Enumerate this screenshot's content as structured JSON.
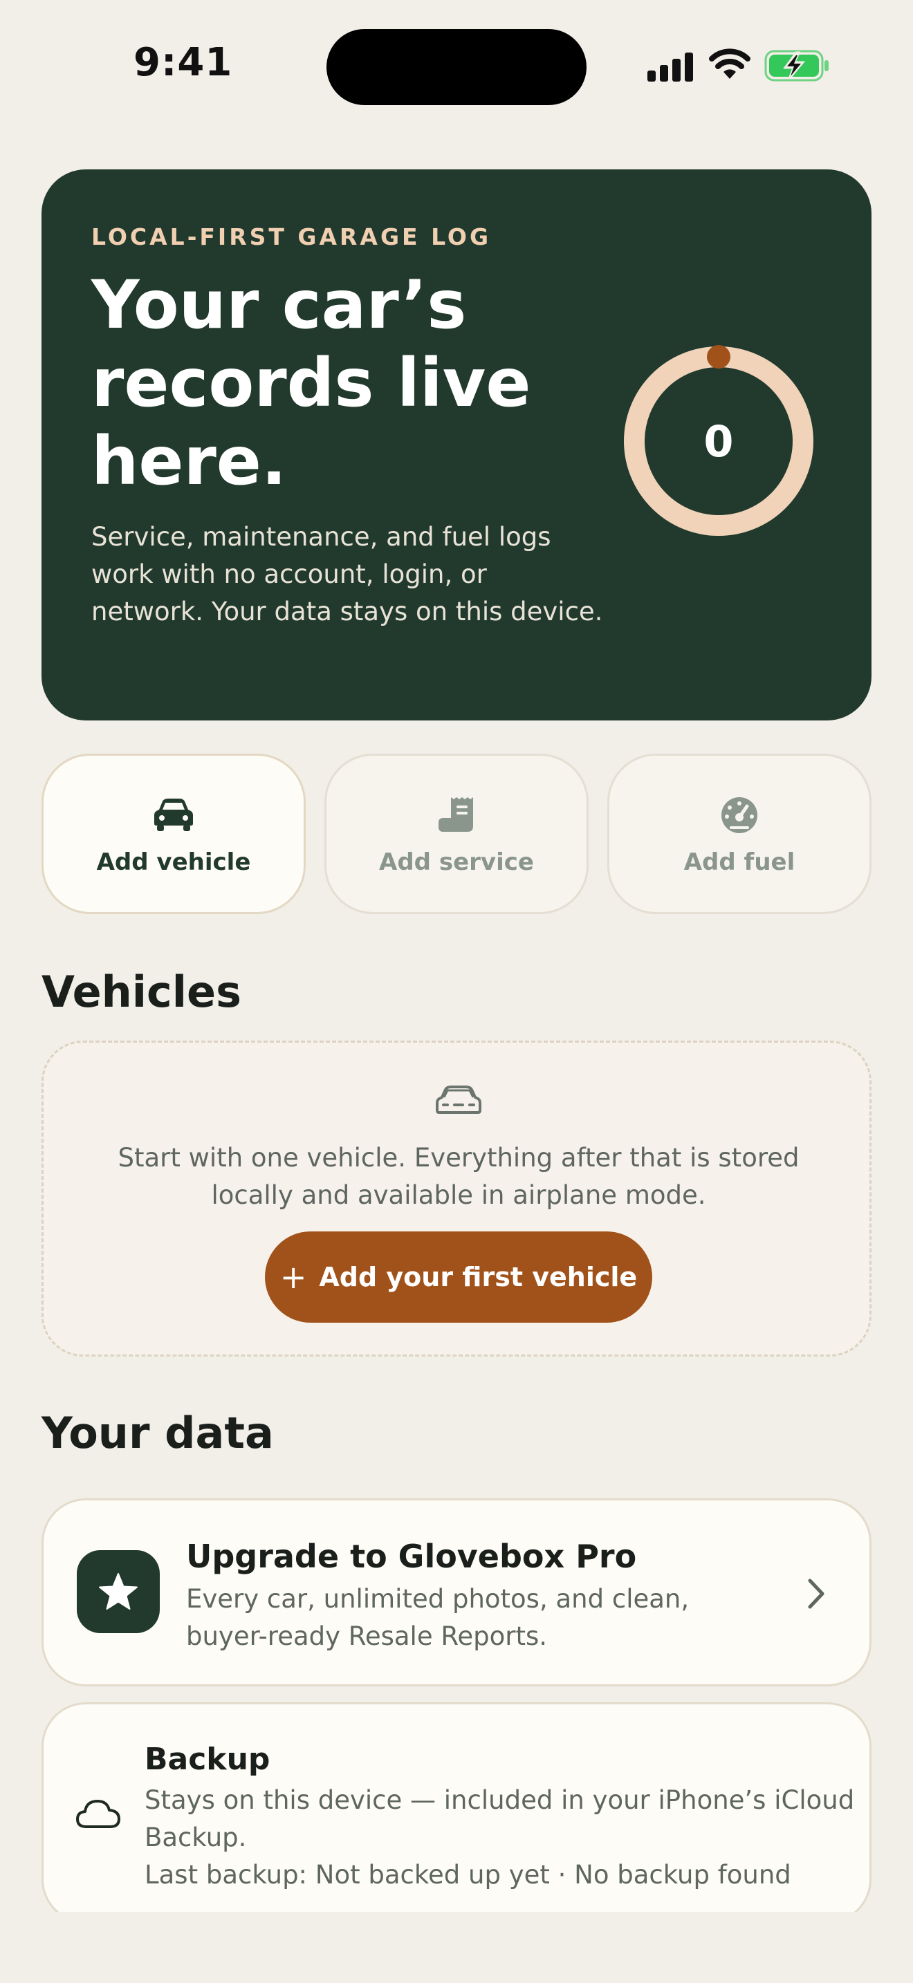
{
  "status_bar": {
    "time": "9:41"
  },
  "hero": {
    "kicker": "LOCAL-FIRST GARAGE LOG",
    "title_lines": [
      "Your car’s",
      "records live",
      "here."
    ],
    "body": "Service, maintenance, and fuel logs work with no account, login, or network. Your data stays on this device.",
    "count": "0",
    "colors": {
      "background": "#213A2D",
      "ring": "#F1D3BA",
      "ring_marker": "#A1521A"
    }
  },
  "actions": [
    {
      "label": "Add vehicle",
      "icon": "car-icon"
    },
    {
      "label": "Add service",
      "icon": "receipt-icon"
    },
    {
      "label": "Add fuel",
      "icon": "gauge-icon"
    }
  ],
  "vehicles": {
    "title": "Vehicles",
    "empty_icon": "car-outline-icon",
    "empty_text": "Start with one vehicle. Everything after that is stored locally and available in airplane mode.",
    "cta_icon": "+",
    "cta_label": "Add your first vehicle"
  },
  "your_data": {
    "title": "Your data",
    "pro": {
      "icon": "star-icon",
      "title": "Upgrade to Glovebox Pro",
      "description": "Every car, unlimited photos, and clean, buyer-ready Resale Reports."
    },
    "backup": {
      "icon": "cloud-icon",
      "title": "Backup",
      "description": "Stays on this device — included in your iPhone’s iCloud Backup.",
      "last_backup": "Last backup: Not backed up yet · No backup found"
    }
  },
  "theme": {
    "page_background": "#F2EEE8",
    "accent": "#A1521A",
    "brand_dark": "#213A2D"
  }
}
